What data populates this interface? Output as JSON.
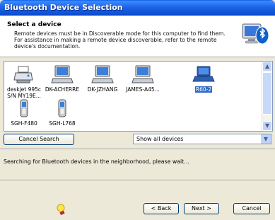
{
  "window": {
    "title": "Bluetooth Device Selection"
  },
  "header": {
    "title": "Select a device",
    "description": "Remote devices must be in Discoverable mode for this computer to find them. For assistance in making a remote device discoverable, refer to the remote device's documentation."
  },
  "devices": [
    {
      "label": "deskjet 995c S/N MY19E...",
      "icon": "printer-icon",
      "selected": false
    },
    {
      "label": "DK-ACHERRE",
      "icon": "computer-icon",
      "selected": false
    },
    {
      "label": "DK-JZHANG",
      "icon": "computer-icon",
      "selected": false
    },
    {
      "label": "JAMES-A45...",
      "icon": "computer-icon",
      "selected": false
    },
    {
      "label": "R60-2",
      "icon": "laptop-icon",
      "selected": true
    },
    {
      "label": "SGH-F480",
      "icon": "phone-icon",
      "selected": false
    },
    {
      "label": "SGH-L768",
      "icon": "phone-icon",
      "selected": false
    }
  ],
  "buttons": {
    "cancel_search": "Cancel Search",
    "back": "< Back",
    "next": "Next >",
    "cancel": "Cancel"
  },
  "filter": {
    "selected": "Show all devices"
  },
  "status": {
    "text": "Searching for Bluetooth devices in the neighborhood, please wait..."
  }
}
